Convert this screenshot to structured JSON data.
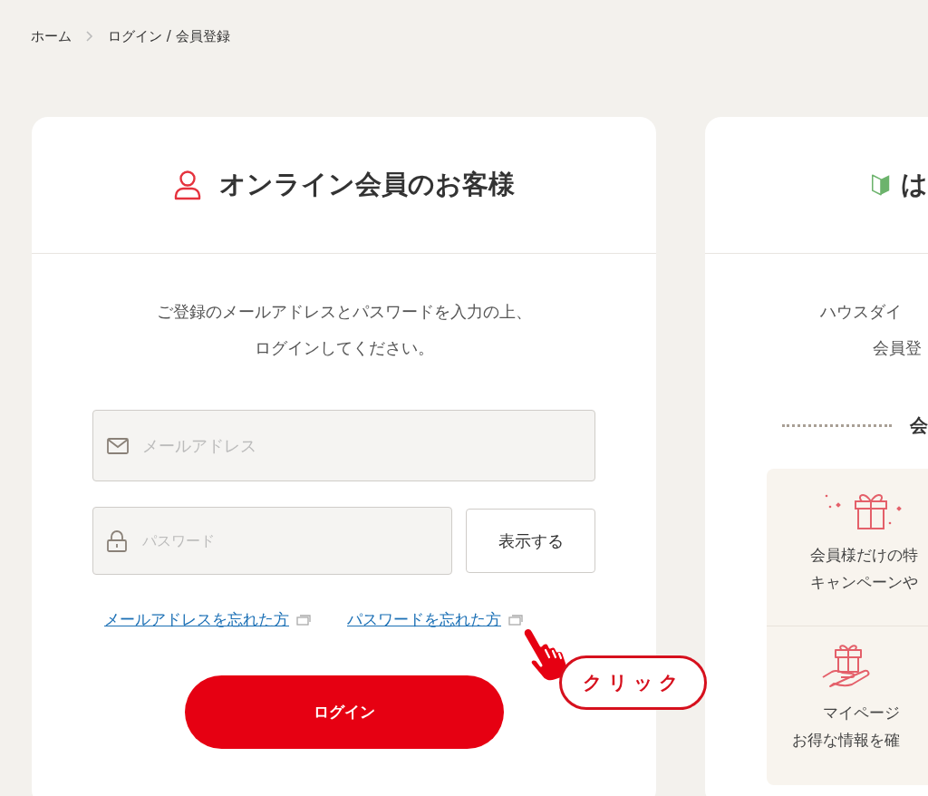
{
  "breadcrumb": [
    {
      "label": "ホーム"
    },
    {
      "label": "ログイン / 会員登録"
    }
  ],
  "login_card": {
    "title": "オンライン会員のお客様",
    "description": [
      "ご登録のメールアドレスとパスワードを入力の上、",
      "ログインしてください。"
    ],
    "email_field": {
      "placeholder": "メールアドレス"
    },
    "password_field": {
      "placeholder": "パスワード"
    },
    "show_button": "表示する",
    "links": [
      {
        "label": "メールアドレスを忘れた方"
      },
      {
        "label": "パスワードを忘れた方"
      }
    ],
    "login_button": "ログイン",
    "callout": "クリック"
  },
  "register_card": {
    "title": "は",
    "description": [
      "ハウスダイ",
      "会員登"
    ],
    "section_heading": "会",
    "benefits": [
      {
        "kind": "gift",
        "lines": [
          "会員様だけの特",
          "キャンペーンや"
        ]
      },
      {
        "kind": "hand",
        "lines": [
          "マイページ",
          "お得な情報を確"
        ]
      }
    ]
  }
}
